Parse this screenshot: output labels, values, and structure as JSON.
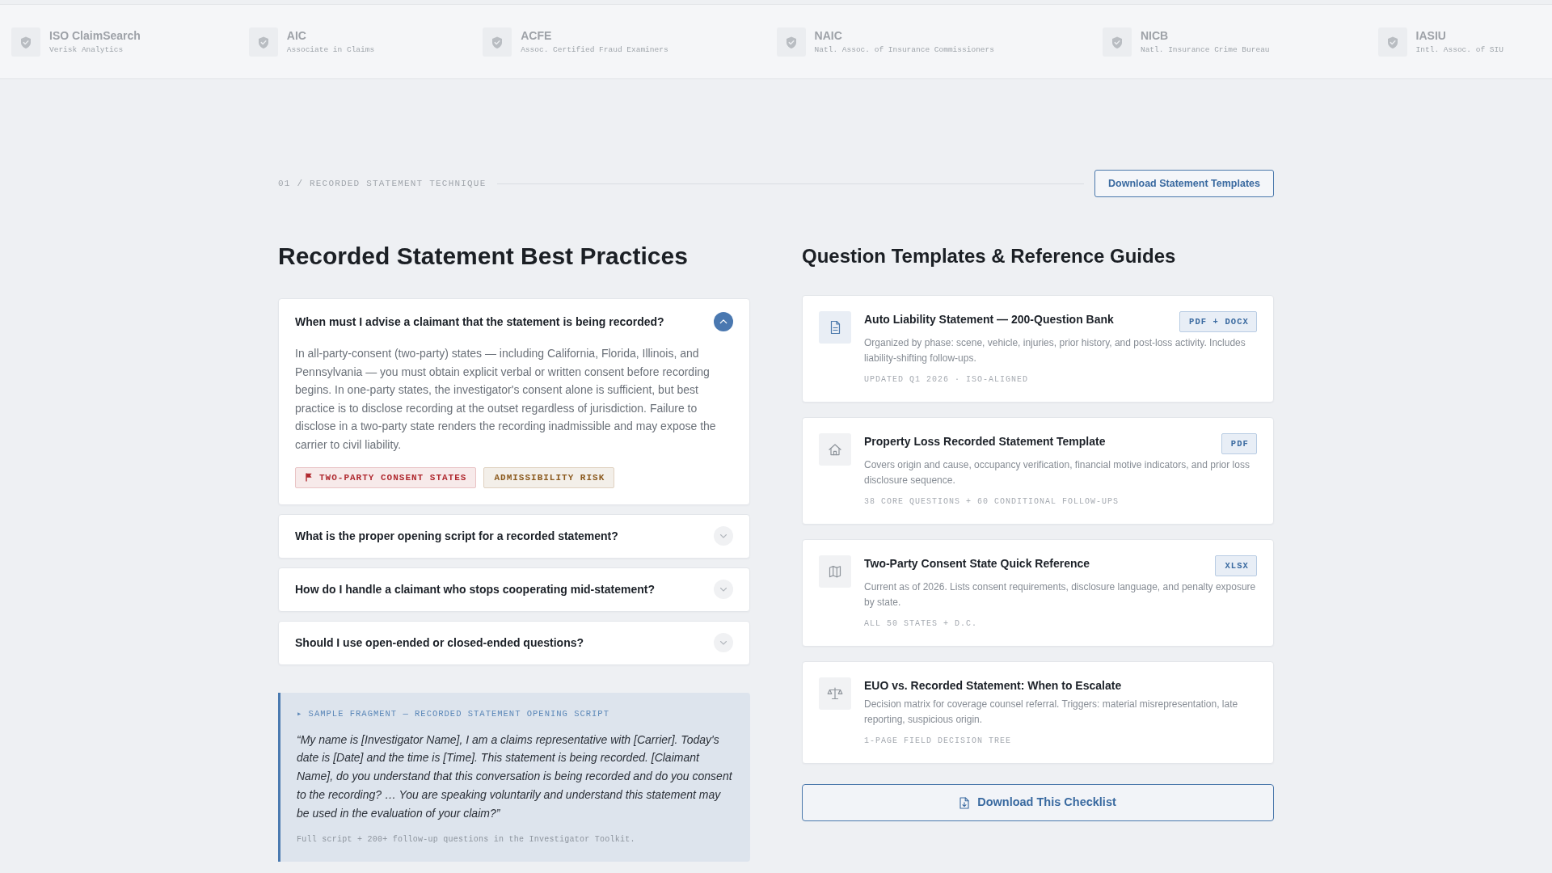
{
  "partners": [
    {
      "name": "ISO ClaimSearch",
      "subtitle": "Verisk Analytics"
    },
    {
      "name": "AIC",
      "subtitle": "Associate in Claims"
    },
    {
      "name": "ACFE",
      "subtitle": "Assoc. Certified Fraud Examiners"
    },
    {
      "name": "NAIC",
      "subtitle": "Natl. Assoc. of Insurance Commissioners"
    },
    {
      "name": "NICB",
      "subtitle": "Natl. Insurance Crime Bureau"
    },
    {
      "name": "IASIU",
      "subtitle": "Intl. Assoc. of SIU"
    }
  ],
  "section_header": {
    "eyebrow": "01 / RECORDED STATEMENT TECHNIQUE",
    "button": "Download Statement Templates"
  },
  "faq": {
    "title": "Recorded Statement Best Practices",
    "items": [
      {
        "question": "When must I advise a claimant that the statement is being recorded?",
        "expanded": true,
        "answer": "In all-party-consent (two-party) states — including California, Florida, Illinois, and Pennsylvania — you must obtain explicit verbal or written consent before recording begins. In one-party states, the investigator's consent alone is sufficient, but best practice is to disclose recording at the outset regardless of jurisdiction. Failure to disclose in a two-party state renders the recording inadmissible and may expose the carrier to civil liability.",
        "tags": [
          {
            "label": "TWO-PARTY CONSENT STATES",
            "flagged": true,
            "color": "#b02a30"
          },
          {
            "label": "ADMISSIBILITY RISK",
            "flagged": false,
            "color": "#8b5a1e"
          }
        ]
      },
      {
        "question": "What is the proper opening script for a recorded statement?",
        "expanded": false
      },
      {
        "question": "How do I handle a claimant who stops cooperating mid-statement?",
        "expanded": false
      },
      {
        "question": "Should I use open-ended or closed-ended questions?",
        "expanded": false
      }
    ]
  },
  "sample": {
    "label": "▸ SAMPLE FRAGMENT — RECORDED STATEMENT OPENING SCRIPT",
    "quote": "“My name is [Investigator Name], I am a claims representative with [Carrier]. Today's date is [Date] and the time is [Time]. This statement is being recorded. [Claimant Name], do you understand that this conversation is being recorded and do you consent to the recording? … You are speaking voluntarily and understand this statement may be used in the evaluation of your claim?”",
    "note": "Full script + 200+ follow-up questions in the Investigator Toolkit."
  },
  "resources": {
    "title": "Question Templates & Reference Guides",
    "items": [
      {
        "kind": "question-bank",
        "highlighted": true,
        "title": "Auto Liability Statement — 200-Question Bank",
        "format": "PDF + DOCX",
        "description": "Organized by phase: scene, vehicle, injuries, prior history, and post-loss activity. Includes liability-shifting follow-ups.",
        "meta": "UPDATED Q1 2026 · ISO-ALIGNED"
      },
      {
        "kind": "property-template",
        "highlighted": false,
        "title": "Property Loss Recorded Statement Template",
        "format": "PDF",
        "description": "Covers origin and cause, occupancy verification, financial motive indicators, and prior loss disclosure sequence.",
        "meta": "38 CORE QUESTIONS + 60 CONDITIONAL FOLLOW-UPS"
      },
      {
        "kind": "state-reference",
        "highlighted": false,
        "title": "Two-Party Consent State Quick Reference",
        "format": "XLSX",
        "description": "Current as of 2026. Lists consent requirements, disclosure language, and penalty exposure by state.",
        "meta": "ALL 50 STATES + D.C."
      },
      {
        "kind": "decision-matrix",
        "highlighted": false,
        "title": "EUO vs. Recorded Statement: When to Escalate",
        "description": "Decision matrix for coverage counsel referral. Triggers: material misrepresentation, late reporting, suspicious origin.",
        "meta": "1-PAGE FIELD DECISION TREE"
      }
    ],
    "button": "Download This Checklist"
  }
}
